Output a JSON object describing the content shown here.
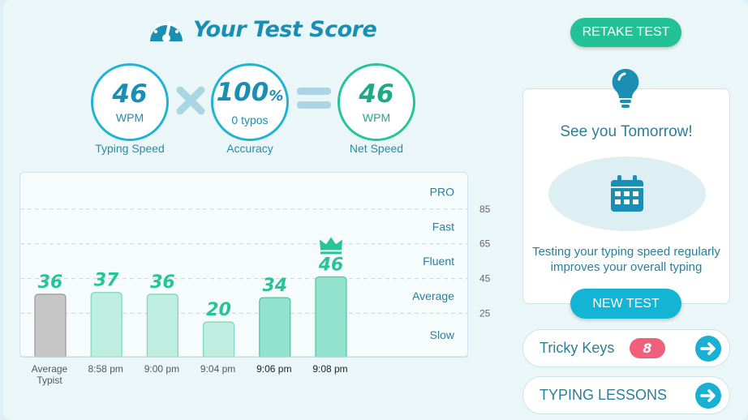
{
  "title": "Your Test Score",
  "retake_label": "RETAKE TEST",
  "stats": {
    "typing_speed": {
      "value": "46",
      "unit": "WPM",
      "label": "Typing Speed"
    },
    "accuracy": {
      "value": "100",
      "suffix": "%",
      "sub": "0 typos",
      "label": "Accuracy"
    },
    "net_speed": {
      "value": "46",
      "unit": "WPM",
      "label": "Net Speed"
    }
  },
  "chart_data": {
    "type": "bar",
    "categories": [
      "Average Typist",
      "8:58 pm",
      "9:00 pm",
      "9:04 pm",
      "9:06 pm",
      "9:08 pm"
    ],
    "values": [
      36,
      37,
      36,
      20,
      34,
      46
    ],
    "ylim": [
      0,
      105
    ],
    "grid_ticks": [
      25,
      45,
      65,
      85
    ],
    "bands": [
      "Slow",
      "Average",
      "Fluent",
      "Fast",
      "PRO"
    ],
    "highlight_index": 5,
    "colors": {
      "average": "#c6c6c6",
      "light": "#bdeee0",
      "mid": "#92e3cd",
      "value_text": "#27c49a"
    }
  },
  "card": {
    "title": "See you Tomorrow!",
    "desc_line1": "Testing your typing speed regularly",
    "desc_line2": "improves your overall typing"
  },
  "new_test_label": "NEW TEST",
  "tricky_keys": {
    "label": "Tricky Keys",
    "count": "8"
  },
  "lessons_label": "TYPING LESSONS",
  "icons": [
    "speedometer-icon",
    "lightbulb-icon",
    "calendar-icon",
    "arrow-right-icon",
    "crown-icon"
  ]
}
